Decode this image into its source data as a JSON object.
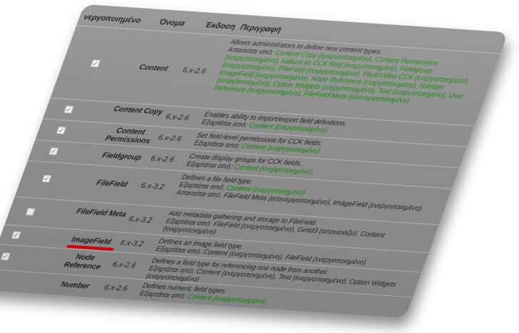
{
  "headers": {
    "enabled": "νεργοποιημένο",
    "name": "Όνομα",
    "version": "Έκδοση",
    "description": "Περιγραφή"
  },
  "modules": [
    {
      "name": "Content",
      "version": "6.x-2.6",
      "checked": true,
      "desc_main": "Allows administrators to define new content types.",
      "desc_required_by_label": "Απαιτείται από: ",
      "desc_required_by": "Content Copy (ενεργοποιημένο), Content Permissions (ενεργοποιημένο), kaltura as CCK field (ενεργοποιημένο), Fieldgroup (ενεργοποιημένο), FileField (ενεργοποιημένο), FlashVideo CCK (ενεργοποιημένο), ImageField (ενεργοποιημένο), Node Reference (ενεργοποιημένο), Number (ενεργοποιημένο), Option Widgets (ενεργοποιημένο), Text (ενεργοποιημένο), User Reference (ενεργοποιημένο), FileField Meta (απενεργοποιημένο)"
    },
    {
      "name": "Content Copy",
      "version": "6.x-2.6",
      "checked": true,
      "desc_main": "Enables ability to import/export field definitions.",
      "desc_depends_label": "Εξαρτάται από: ",
      "desc_depends": "Content (ενεργοποιημένο)"
    },
    {
      "name": "Content Permissions",
      "version": "6.x-2.6",
      "checked": true,
      "desc_main": "Set field-level permissions for CCK fields.",
      "desc_depends_label": "Εξαρτάται από: ",
      "desc_depends": "Content (ενεργοποιημένο)"
    },
    {
      "name": "Fieldgroup",
      "version": "6.x-2.6",
      "checked": true,
      "desc_main": "Create display groups for CCK fields.",
      "desc_depends_label": "Εξαρτάται από: ",
      "desc_depends": "Content (ενεργοποιημένο)"
    },
    {
      "name": "FileField",
      "version": "6.x-3.2",
      "checked": true,
      "desc_main": "Defines a file field type.",
      "desc_depends_label": "Εξαρτάται από: ",
      "desc_depends": "Content (ενεργοποιημένο)",
      "desc_required_by_label": "Απαιτείται από: ",
      "desc_required_by": "FileField Meta (απενεργοποιημένο), ImageField (ενεργοποιημένο)"
    },
    {
      "name": "FileField Meta",
      "version": "6.x-3.2",
      "checked": false,
      "desc_main": "Add metadata gathering and storage to FileField.",
      "desc_depends_label": "Εξαρτάται από: ",
      "desc_depends": "FileField (ενεργοποιημένο), Getid3 (απουσιάζει), Content (ενεργοποιημένο)"
    },
    {
      "name": "ImageField",
      "version": "6.x-3.2",
      "checked": true,
      "desc_main": "Defines an image field type.",
      "desc_depends_label": "Εξαρτάται από: ",
      "desc_depends": "Content (ενεργοποιημένο), FileField (ενεργοποιημένο)"
    },
    {
      "name": "Node Reference",
      "version": "6.x-2.6",
      "checked": true,
      "desc_main": "Defines a field type for referencing one node from another.",
      "desc_depends_label": "Εξαρτάται από: ",
      "desc_depends": "Content (ενεργοποιημένο), Text (ενεργοποιημένο), Option Widgets (ενεργοποιημένο)"
    },
    {
      "name": "Number",
      "version": "6.x-2.6",
      "checked": true,
      "desc_main": "Defines numeric field types.",
      "desc_depends_label": "Εξαρτάται από: ",
      "desc_depends": "Content (ενεργοποιημένο)"
    }
  ],
  "colors": {
    "enabled": "#0d8a00",
    "disabled": "#c40000",
    "highlight_underline": "#e00000"
  },
  "highlighted_module": "ImageField"
}
